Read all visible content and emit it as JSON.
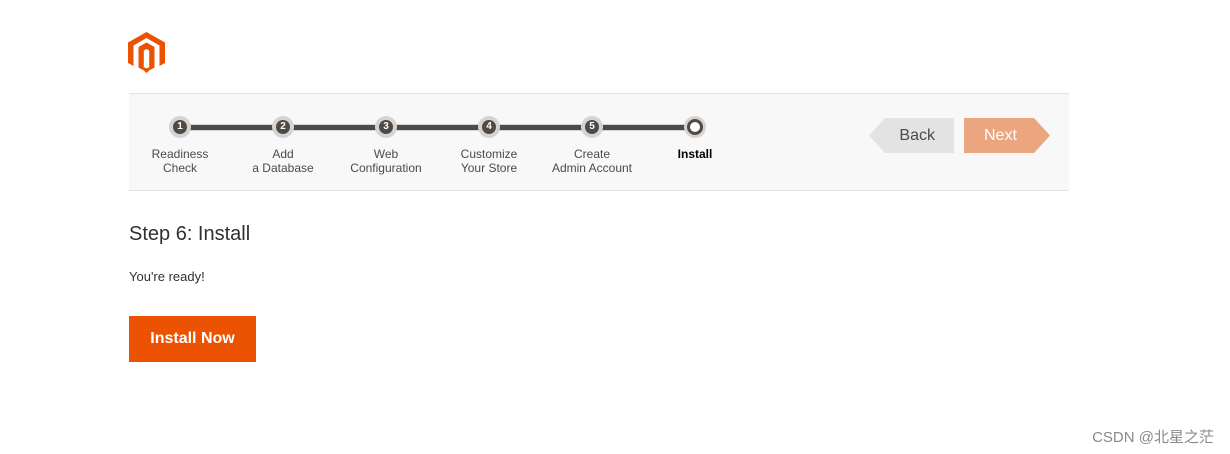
{
  "brand": {
    "logo_icon": "magento-logo-icon",
    "accent": "#eb5202"
  },
  "wizard": {
    "steps": [
      {
        "number": "1",
        "label_line1": "Readiness",
        "label_line2": "Check"
      },
      {
        "number": "2",
        "label_line1": "Add",
        "label_line2": "a Database"
      },
      {
        "number": "3",
        "label_line1": "Web",
        "label_line2": "Configuration"
      },
      {
        "number": "4",
        "label_line1": "Customize",
        "label_line2": "Your Store"
      },
      {
        "number": "5",
        "label_line1": "Create",
        "label_line2": "Admin Account"
      },
      {
        "number": "",
        "label_line1": "Install",
        "label_line2": ""
      }
    ],
    "back_label": "Back",
    "next_label": "Next"
  },
  "main": {
    "title": "Step 6: Install",
    "ready_text": "You're ready!",
    "install_button": "Install Now"
  },
  "watermark": "CSDN @北星之茫"
}
